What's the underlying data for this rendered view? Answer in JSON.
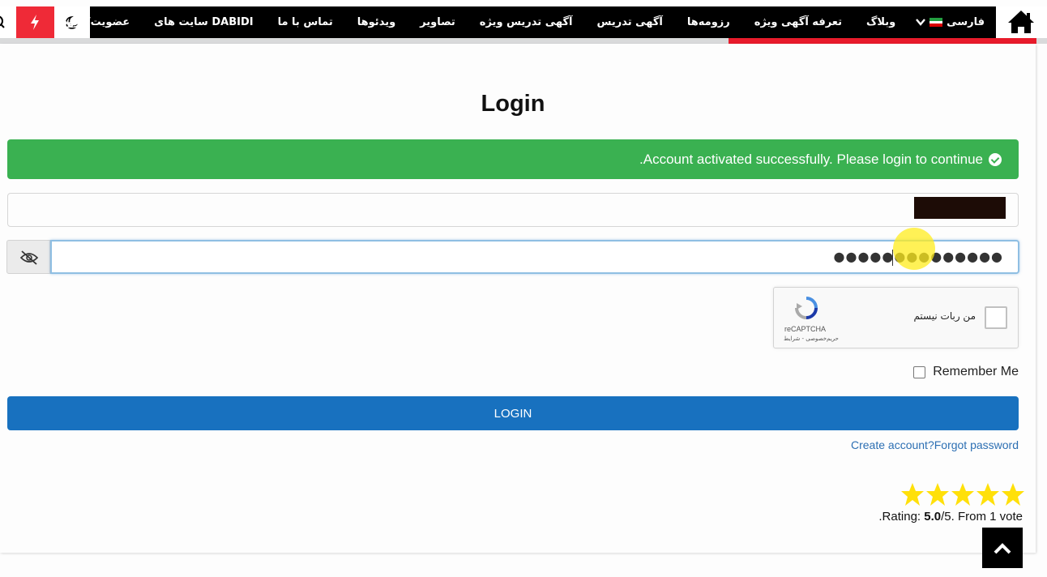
{
  "nav": {
    "home_icon": "home-icon",
    "language_label": "فارسی",
    "items": [
      "وبلاگ",
      "تعرفه آگهی ویژه",
      "رزومه‌ها",
      "آگهی تدریس",
      "آگهی تدریس ویژه",
      "تصاویر",
      "ویدئوها",
      "تماس با ما",
      "سایت های DABIDI",
      "عضویت/ورود"
    ],
    "tools": [
      "moon-icon",
      "flash-icon",
      "search-icon"
    ]
  },
  "page": {
    "title": "Login",
    "alert_text": ".Account activated successfully. Please login to continue",
    "password_mask": "●●●●●●●●●●●●●●",
    "remember_label": "Remember Me",
    "login_label": "LOGIN",
    "links_text": "Create account?Forgot password"
  },
  "recaptcha": {
    "label": "من ربات نیستم",
    "brand": "reCAPTCHA",
    "terms": "حریم‌خصوصی - شرایط"
  },
  "rating": {
    "stars": 5,
    "prefix": ".Rating: ",
    "value": "5.0",
    "suffix": "/5. From 1 vote"
  },
  "colors": {
    "alert_bg": "#3ab151",
    "button_bg": "#1871bf",
    "nav_bg": "#000000",
    "accent_red": "#e81b2b",
    "star": "#ffe00a"
  }
}
